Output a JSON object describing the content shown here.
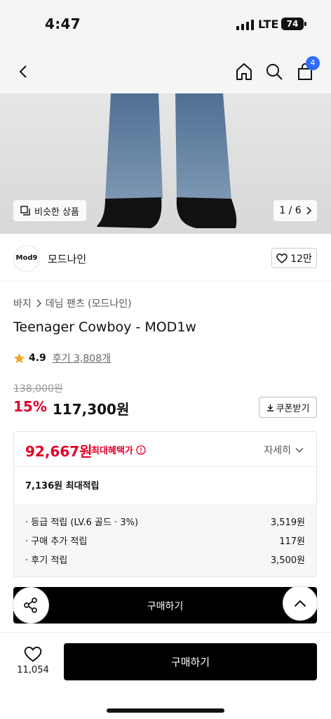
{
  "status_bar": {
    "time": "4:47",
    "network": "LTE",
    "battery": "74"
  },
  "nav": {
    "back_icon": "chevron-left-icon",
    "home_icon": "home-icon",
    "search_icon": "search-icon",
    "cart_icon": "shopping-bag-icon",
    "cart_count": "4"
  },
  "hero": {
    "similar_label": "비슷한 상품",
    "page_indicator": "1 / 6"
  },
  "brand": {
    "logo_text": "Mod9",
    "name": "모드나인",
    "like_count": "12만"
  },
  "product": {
    "breadcrumb": [
      "바지",
      "데님 팬츠 (모드나인)"
    ],
    "title": "Teenager Cowboy - MOD1w",
    "rating": "4.9",
    "reviews": "후기 3,808개",
    "original_price": "138,000원",
    "discount_rate": "15%",
    "sale_price": "117,300원",
    "coupon_label": "쿠폰받기"
  },
  "benefit": {
    "max_price": "92,667원",
    "max_label": "최대혜택가",
    "detail_label": "자세히",
    "points_total": "7,136원 최대적립",
    "points": [
      {
        "label": "· 등급 적립 (LV.6 골드 · 3%)",
        "value": "3,519원"
      },
      {
        "label": "· 구매 추가 적립",
        "value": "117원"
      },
      {
        "label": "· 후기 적립",
        "value": "3,500원"
      }
    ]
  },
  "sticky": {
    "label": "구매하기"
  },
  "bottom": {
    "wish_count": "11,054",
    "buy_label": "구매하기"
  },
  "colors": {
    "accent_red": "#e4002b",
    "badge_blue": "#2f6bff",
    "primary_black": "#000000"
  }
}
